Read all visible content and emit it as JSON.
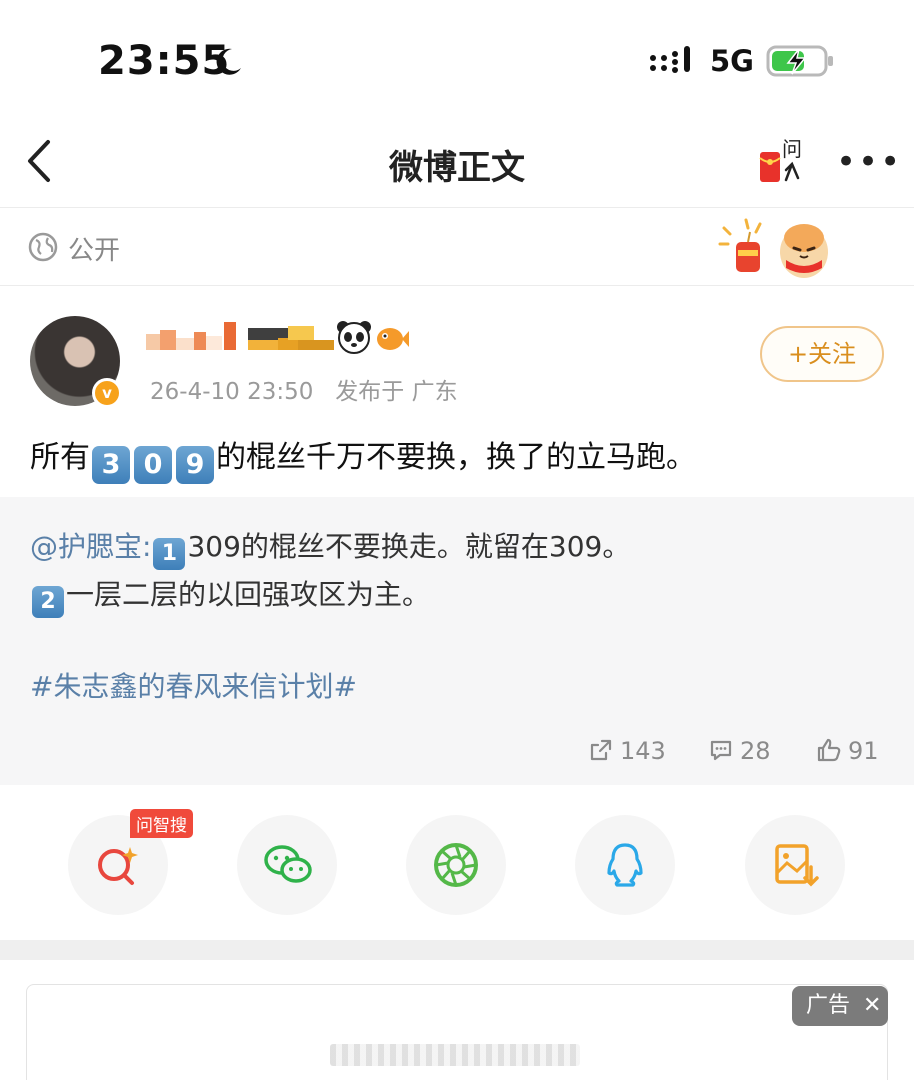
{
  "status_bar": {
    "time": "23:55",
    "network": "5G",
    "battery_level": 0.6,
    "charging": true
  },
  "nav": {
    "title": "微博正文",
    "ask_icon_text": "问",
    "more": "•••"
  },
  "visibility": {
    "label": "公开"
  },
  "author": {
    "verified_badge": "v",
    "time": "26-4-10 23:50",
    "published_prefix": "发布于",
    "location": "广东",
    "follow_label": "+关注"
  },
  "post": {
    "prefix": "所有",
    "keycaps": [
      "3",
      "0",
      "9"
    ],
    "suffix": "的棍丝千万不要换，换了的立马跑。"
  },
  "repost": {
    "user": "@护腮宝:",
    "item1_num": "1",
    "item1_text": "309的棍丝不要换走。就留在309。",
    "item2_num": "2",
    "item2_text": "一层二层的以回强攻区为主。",
    "hashtag": "#朱志鑫的春风来信计划#",
    "reposts": "143",
    "comments": "28",
    "likes": "91"
  },
  "share": {
    "hot_tag": "问智搜",
    "items": [
      "ai-search-icon",
      "wechat-icon",
      "moments-icon",
      "qq-icon",
      "save-image-icon"
    ]
  },
  "ad": {
    "label": "广告",
    "close": "✕"
  },
  "colors": {
    "accent_orange": "#d98e1e",
    "link_blue": "#5a80a8",
    "keycap_blue": "#3e7fb9",
    "hot_red": "#f04a3b"
  }
}
